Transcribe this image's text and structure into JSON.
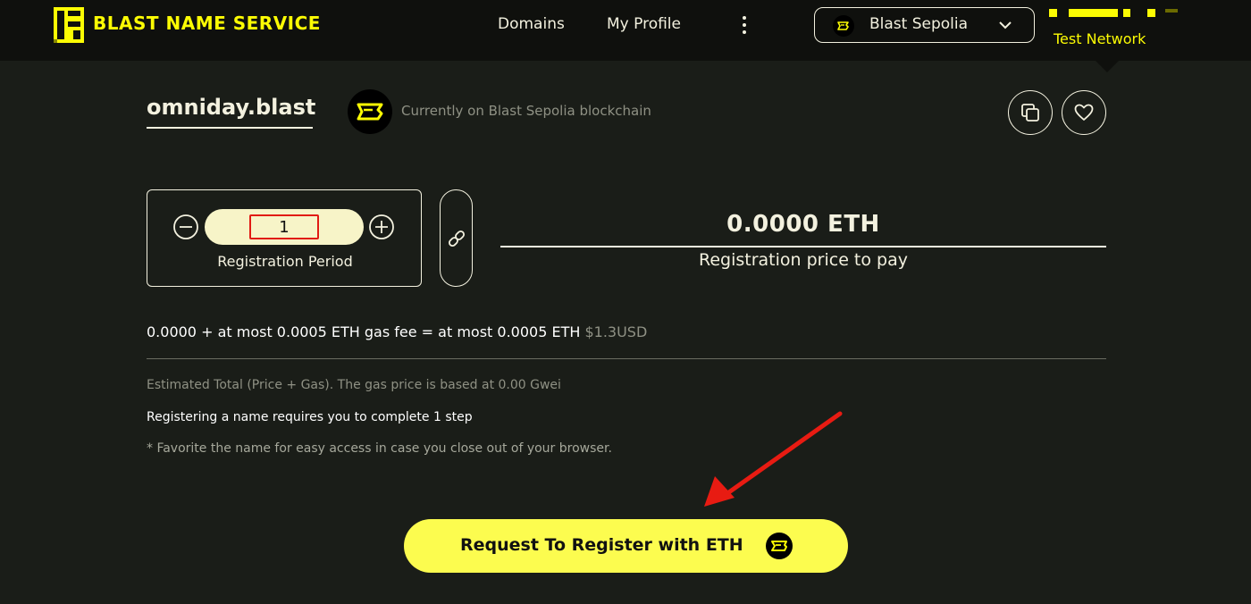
{
  "header": {
    "brand": "BLAST NAME SERVICE",
    "nav": [
      {
        "label": "Domains"
      },
      {
        "label": "My Profile"
      }
    ],
    "network": {
      "label": "Blast Sepolia"
    },
    "network_badge": "Test Network"
  },
  "domain": {
    "name": "omniday.blast",
    "chain_status": "Currently on Blast Sepolia blockchain"
  },
  "registration": {
    "period_value": "1",
    "period_label": "Registration Period",
    "price_value": "0.0000 ETH",
    "price_label": "Registration price to pay"
  },
  "summary": {
    "cost_breakdown": "0.0000 + at most 0.0005 ETH gas fee = at most 0.0005 ETH",
    "cost_usd": "$1.3USD",
    "estimate_note": "Estimated Total (Price + Gas). The gas price is based at 0.00 Gwei",
    "steps_note": "Registering a name requires you to complete 1 step",
    "favorite_note": "* Favorite the name for easy access in case you close out of your browser."
  },
  "register_button": {
    "label": "Request To Register with ETH"
  },
  "icons": {
    "logo": "blast-logo-icon",
    "network": "blast-chain-icon",
    "copy": "copy-icon",
    "favorite": "heart-icon",
    "link": "link-icon",
    "minus": "minus-circle-icon",
    "plus": "plus-circle-icon"
  },
  "colors": {
    "accent": "#fcfc03",
    "button": "#fcfc4f",
    "background": "#1a1d18",
    "header": "#0f100d",
    "highlight": "#e11b14"
  }
}
